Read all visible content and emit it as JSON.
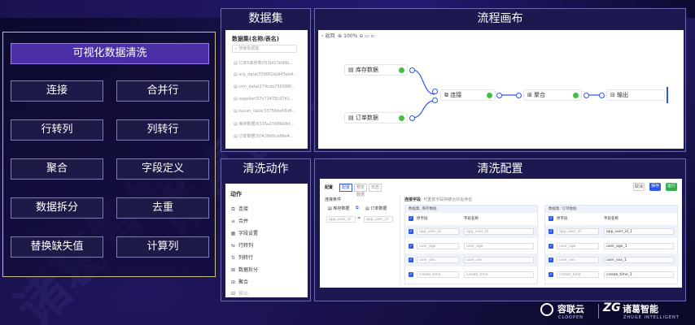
{
  "left": {
    "title": "可视化数据清洗",
    "buttons": [
      "连接",
      "合并行",
      "行转列",
      "列转行",
      "聚合",
      "字段定义",
      "数据拆分",
      "去重",
      "替换缺失值",
      "计算列"
    ]
  },
  "dataset": {
    "panel_title": "数据集",
    "header": "数据集(名称/表名)",
    "search_placeholder": "搜索数据集",
    "items": [
      "订单5库存表(f33bf23e9db...",
      "erp_data(3380f2ab943eb4...",
      "crm_data(274cda756586f...",
      "supplier(57c71478c57b1...",
      "kucun_data(33756be56d6...",
      "库存数据(6335a15986b8d...",
      "订单数据(50428d0ca96e4..."
    ]
  },
  "flow": {
    "panel_title": "流程画布",
    "toolbar": {
      "back": "返回",
      "zoom": "100%"
    },
    "nodes": [
      "库存数据",
      "订单数据",
      "连接",
      "聚合",
      "输出"
    ]
  },
  "actions": {
    "panel_title": "清洗动作",
    "header": "动作",
    "items": [
      "连接",
      "合并",
      "字段设置",
      "行转列",
      "列转行",
      "数据拆分",
      "聚合",
      "输出"
    ]
  },
  "config": {
    "panel_title": "清洗配置",
    "label": "配置",
    "tabs": [
      "配置",
      "预览数据",
      "日志"
    ],
    "btn_cancel": "取消",
    "btn_save": "保存",
    "btn_run": "运行",
    "join_cond": "连接条件",
    "src_a": "库存数据",
    "src_b": "订单数据",
    "field_a": "app_user_id",
    "field_b": "app_user_id",
    "join_field_label": "连接字段",
    "join_field_hint": "可重复字段将被合并后命名",
    "table_left": {
      "head": "数据集: 库存数据",
      "col1": "原字段",
      "col2": "字段名称",
      "rows": [
        [
          "app_user_id",
          "app_user_id"
        ],
        [
          "user_age",
          "user_age"
        ],
        [
          "user_sex",
          "user_sex"
        ],
        [
          "create_time",
          "create_time"
        ]
      ]
    },
    "table_right": {
      "head": "数据集: 订单数据",
      "col1": "原字段",
      "col2": "字段名称",
      "rows": [
        [
          "app_user_id",
          "app_user_id_1"
        ],
        [
          "user_age",
          "user_age_1"
        ],
        [
          "user_sex",
          "user_sex_1"
        ],
        [
          "create_time",
          "create_time_1"
        ]
      ]
    }
  },
  "brands": {
    "a_name": "容联云",
    "a_sub": "CLOOPEN",
    "b_name": "诸葛智能",
    "b_sub": "ZHUGE INTELLIGENT"
  },
  "watermark": "诸葛智能"
}
